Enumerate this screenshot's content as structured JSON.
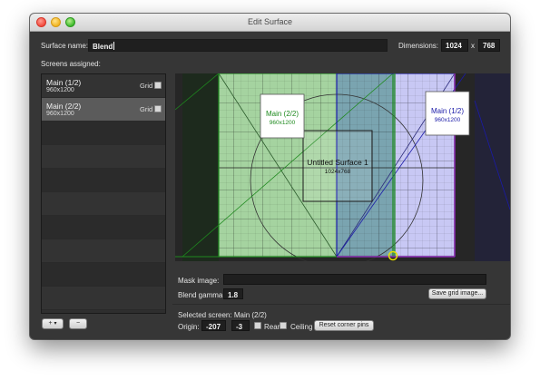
{
  "window": {
    "title": "Edit Surface"
  },
  "surface": {
    "name_label": "Surface name:",
    "name_value": "Blend",
    "dimensions_label": "Dimensions:",
    "width": "1024",
    "times": "x",
    "height": "768"
  },
  "screens": {
    "label": "Screens assigned:",
    "grid_label": "Grid",
    "items": [
      {
        "name": "Main (1/2)",
        "resolution": "960x1200",
        "selected": false
      },
      {
        "name": "Main (2/2)",
        "resolution": "960x1200",
        "selected": true
      }
    ],
    "add_label": "+",
    "add_menu_label": "▾",
    "remove_label": "−"
  },
  "preview": {
    "surface_title": "Untitled Surface 1",
    "surface_res": "1024x768",
    "screen_a": {
      "name": "Main (2/2)",
      "res": "960x1200",
      "color": "#1e8a1e"
    },
    "screen_b": {
      "name": "Main (1/2)",
      "res": "960x1200",
      "color": "#1a1aa8"
    }
  },
  "mask": {
    "label": "Mask image:",
    "value": ""
  },
  "gamma": {
    "label": "Blend gamma:",
    "value": "1.8"
  },
  "save_grid_label": "Save grid image...",
  "selected": {
    "label": "Selected screen:",
    "value": "Main (2/2)"
  },
  "origin": {
    "label": "Origin:",
    "x": "-207",
    "y": "-3"
  },
  "rear_label": "Rear",
  "ceiling_label": "Ceiling",
  "reset_label": "Reset corner pins"
}
